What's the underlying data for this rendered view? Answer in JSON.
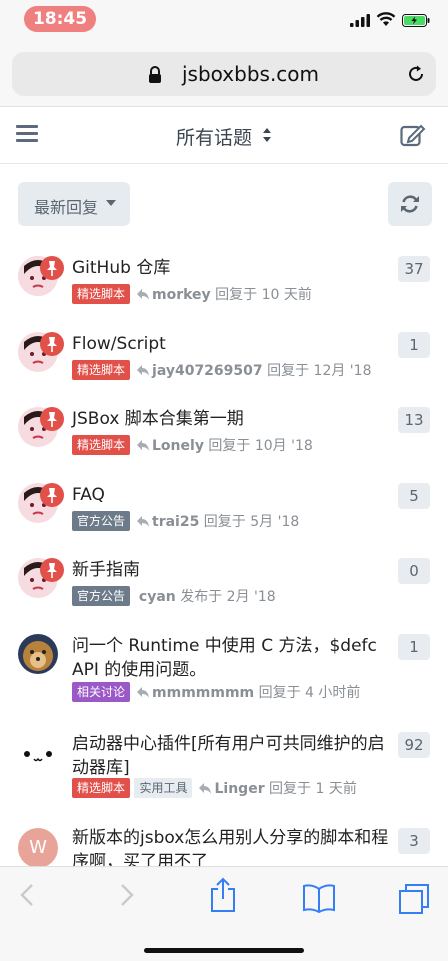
{
  "status": {
    "time": "18:45"
  },
  "browser": {
    "url": "jsboxbbs.com"
  },
  "header": {
    "title": "所有话题"
  },
  "controls": {
    "sort_label": "最新回复"
  },
  "topics": [
    {
      "title_line1": "GitHub 仓库",
      "title_line2": "",
      "tags": [
        "精选脚本"
      ],
      "user": "morkey",
      "action": "回复于 10 天前",
      "count": "37"
    },
    {
      "title_line1": "Flow/Script",
      "title_line2": "",
      "tags": [
        "精选脚本"
      ],
      "user": "jay407269507",
      "action": "回复于 12月 '18",
      "count": "1"
    },
    {
      "title_line1": "JSBox 脚本合集第一期",
      "title_line2": "",
      "tags": [
        "精选脚本"
      ],
      "user": "Lonely",
      "action": "回复于 10月 '18",
      "count": "13"
    },
    {
      "title_line1": "FAQ",
      "title_line2": "",
      "tags": [
        "官方公告"
      ],
      "user": "trai25",
      "action": "回复于 5月 '18",
      "count": "5"
    },
    {
      "title_line1": "新手指南",
      "title_line2": "",
      "tags": [
        "官方公告"
      ],
      "user": "cyan",
      "action": "发布于 2月 '18",
      "count": "0"
    },
    {
      "title_line1": "问一个 Runtime 中使用 C 方法，$defc",
      "title_line2": "API 的使用问题。",
      "tags": [
        "相关讨论"
      ],
      "user": "mmmmmmm",
      "action": "回复于 4 小时前",
      "count": "1"
    },
    {
      "title_line1": "启动器中心插件[所有用户可共同维护的启",
      "title_line2": "动器库]",
      "tags": [
        "精选脚本",
        "实用工具"
      ],
      "user": "Linger",
      "action": "回复于 1 天前",
      "count": "92"
    },
    {
      "title_line1": "新版本的jsbox怎么用别人分享的脚本和程",
      "title_line2": "序啊，买了用不了",
      "tags": [],
      "user": "",
      "action": "",
      "count": "3",
      "avatar_letter": "W"
    }
  ],
  "colors": {
    "pin": "#e2504a",
    "tag_featured": "#e2504a",
    "tag_official": "#6d7a89",
    "tag_discussion": "#9b59c7"
  }
}
